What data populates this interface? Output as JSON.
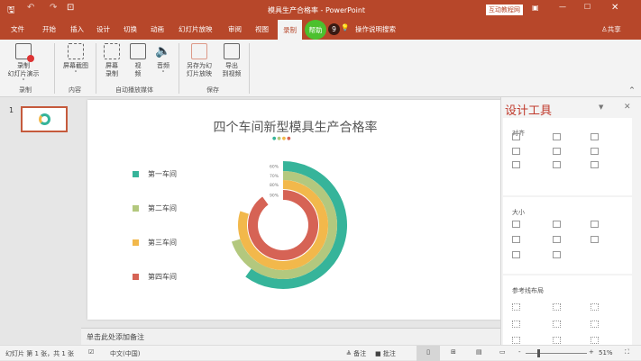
{
  "titlebar": {
    "title": "模具生产合格率 - PowerPoint",
    "badge": "互动教程网"
  },
  "tabs": [
    "文件",
    "开始",
    "插入",
    "设计",
    "切换",
    "动画",
    "幻灯片放映",
    "审阅",
    "视图",
    "录制",
    "帮助"
  ],
  "active_tab": "录制",
  "notif_count": "9",
  "tell_me": "操作说明搜索",
  "share": "共享",
  "ribbon": {
    "buttons": [
      {
        "label1": "录制",
        "label2": "幻灯片演示 ˅"
      },
      {
        "label1": "屏幕截图",
        "label2": "˅"
      },
      {
        "label1": "屏幕",
        "label2": "录制"
      },
      {
        "label1": "视",
        "label2": "频"
      },
      {
        "label1": "音频",
        "label2": "˅"
      },
      {
        "label1": "另存为幻",
        "label2": "灯片放映"
      },
      {
        "label1": "导出",
        "label2": "到视频"
      }
    ],
    "groups": [
      "录制",
      "内容",
      "自动播放媒体",
      "保存"
    ]
  },
  "thumb_number": "1",
  "slide": {
    "title": "四个车间新型模具生产合格率"
  },
  "chart_data": {
    "type": "radial-bar",
    "title": "四个车间新型模具生产合格率",
    "series": [
      {
        "name": "第一车间",
        "value": 60,
        "label": "60%",
        "color": "#36b49a"
      },
      {
        "name": "第二车间",
        "value": 70,
        "label": "70%",
        "color": "#b3c87e"
      },
      {
        "name": "第三车间",
        "value": 80,
        "label": "80%",
        "color": "#f2b84b"
      },
      {
        "name": "第四车间",
        "value": 90,
        "label": "90%",
        "color": "#d66355"
      }
    ],
    "max": 100
  },
  "notes_placeholder": "单击此处添加备注",
  "pane": {
    "title": "设计工具",
    "sections": [
      "对齐",
      "大小",
      "参考线布局"
    ]
  },
  "status": {
    "slide_info": "幻灯片 第 1 张，共 1 张",
    "language": "中文(中国)",
    "notes": "备注",
    "comments": "批注",
    "zoom": "51%",
    "minus": "-",
    "plus": "+"
  }
}
